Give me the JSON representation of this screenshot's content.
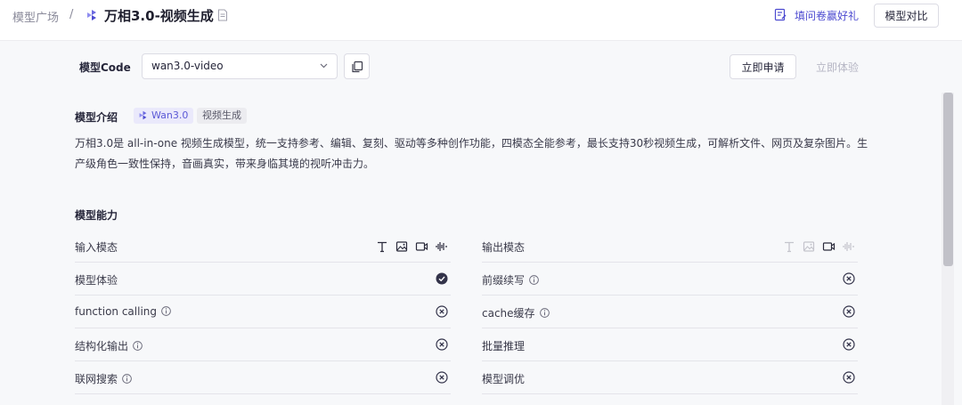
{
  "header": {
    "breadcrumb_root": "模型广场",
    "breadcrumb_sep": "/",
    "title": "万相3.0-视频生成",
    "survey_label": "填问卷赢好礼",
    "compare_label": "模型对比"
  },
  "toolbar": {
    "code_label": "模型Code",
    "code_value": "wan3.0-video",
    "apply_label": "立即申请",
    "try_label": "立即体验"
  },
  "intro": {
    "heading": "模型介绍",
    "tags": [
      "Wan3.0",
      "视频生成"
    ],
    "description": "万相3.0是 all-in-one 视频生成模型，统一支持参考、编辑、复刻、驱动等多种创作功能，四模态全能参考，最长支持30秒视频生成，可解析文件、网页及复杂图片。生产级角色一致性保持，音画真实，带来身临其境的视听冲击力。"
  },
  "capabilities": {
    "heading": "模型能力",
    "left": [
      {
        "label": "输入模态",
        "info": false,
        "status": "modalities"
      },
      {
        "label": "模型体验",
        "info": false,
        "status": "yes"
      },
      {
        "label": "function calling",
        "info": true,
        "status": "no"
      },
      {
        "label": "结构化输出",
        "info": true,
        "status": "no"
      },
      {
        "label": "联网搜索",
        "info": true,
        "status": "no"
      }
    ],
    "right": [
      {
        "label": "输出模态",
        "info": false,
        "status": "modalities"
      },
      {
        "label": "前缀续写",
        "info": true,
        "status": "no"
      },
      {
        "label": "cache缓存",
        "info": true,
        "status": "no"
      },
      {
        "label": "批量推理",
        "info": false,
        "status": "no"
      },
      {
        "label": "模型调优",
        "info": false,
        "status": "no"
      }
    ],
    "input_modalities": {
      "text": true,
      "image": true,
      "video": true,
      "audio": true
    },
    "output_modalities": {
      "text": false,
      "image": false,
      "video": true,
      "audio": false
    }
  },
  "colors": {
    "accent": "#4d4bd0",
    "active_icon": "#2b2b3c",
    "disabled_icon": "#c4c4cc"
  }
}
